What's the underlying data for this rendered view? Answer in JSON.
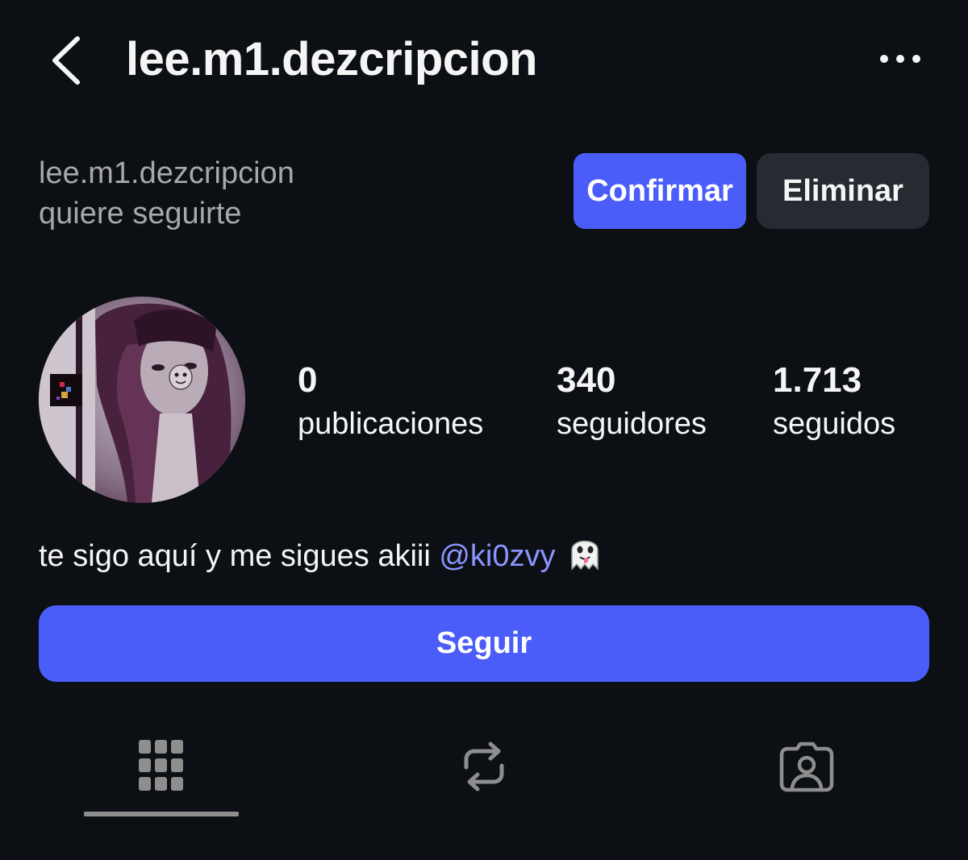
{
  "header": {
    "title": "lee.m1.dezcripcion",
    "back_icon": "chevron-left-icon",
    "more_icon": "more-horizontal-icon"
  },
  "follow_request": {
    "line1": "lee.m1.dezcripcion",
    "line2": "quiere seguirte",
    "confirm_label": "Confirmar",
    "delete_label": "Eliminar"
  },
  "stats": {
    "posts": {
      "value": "0",
      "label": "publicaciones"
    },
    "followers": {
      "value": "340",
      "label": "seguidores"
    },
    "following": {
      "value": "1.713",
      "label": "seguidos"
    }
  },
  "bio": {
    "text": "te sigo aquí y me sigues akiii ",
    "mention": "@ki0zvy",
    "emoji": "ghost-icon"
  },
  "follow_button": {
    "label": "Seguir"
  },
  "tabs": [
    {
      "name": "posts-grid",
      "icon": "grid-icon",
      "active": true
    },
    {
      "name": "reposts",
      "icon": "repost-icon",
      "active": false
    },
    {
      "name": "tagged",
      "icon": "tagged-person-icon",
      "active": false
    }
  ],
  "colors": {
    "background": "#0c1014",
    "primary": "#4a5df9",
    "secondary_button": "#262a31",
    "muted_text": "#a8a8a8",
    "mention": "#8c95ff"
  }
}
